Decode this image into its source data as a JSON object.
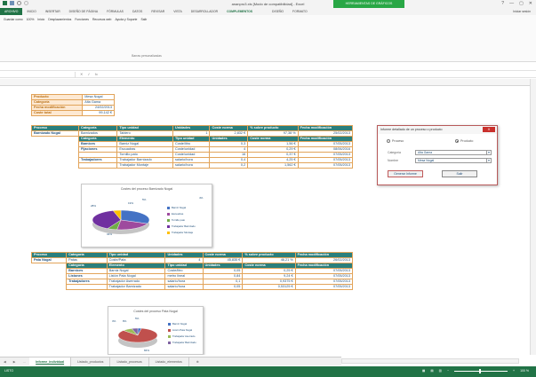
{
  "window": {
    "title": "ananpro3.xls [Modo de compatibilidad] - Excel",
    "tools_label": "HERRAMIENTAS DE GRÁFICOS",
    "controls": [
      "?",
      "—",
      "▢",
      "✕"
    ]
  },
  "ribbon": {
    "tabs": [
      "ARCHIVO",
      "INICIO",
      "INSERTAR",
      "DISEÑO DE PÁGINA",
      "FÓRMULAS",
      "DATOS",
      "REVISAR",
      "VISTA",
      "DESARROLLADOR",
      "COMPLEMENTOS",
      "DISEÑO",
      "FORMATO"
    ],
    "active_tab": "COMPLEMENTOS",
    "user": "Iniciar sesión",
    "toolbar": [
      "Guardar como",
      "100%",
      "Inicio",
      "Desplazamientos",
      "Funciones",
      "Recursos web",
      "Ayuda y Soporte",
      "Salir"
    ],
    "group_label": "Barras personalizadas"
  },
  "formula_bar": {
    "fx": "fx"
  },
  "summary": {
    "rows": [
      {
        "label": "Producto",
        "value": "Mesa Nogal"
      },
      {
        "label": "Categoría",
        "value": "Alta Gama"
      },
      {
        "label": "Fecha modificación",
        "value": "24/02/2013"
      },
      {
        "label": "Coste total",
        "value": "99,142 €"
      }
    ]
  },
  "process1": {
    "header": [
      "Proceso",
      "Categoría",
      "Tipo unidad",
      "Unidades",
      "Coste norma",
      "% sobre producto",
      "Fecha modificación"
    ],
    "main": [
      "Barnizado Nogal",
      "Barnizados",
      "Tablero",
      "1",
      "2,832 €",
      "97,38 %",
      "25/02/2013"
    ],
    "subheader": [
      "Categoría",
      "Elemento",
      "Tipo unidad",
      "Unidades",
      "Coste norma",
      "Fecha modificación"
    ],
    "rows": [
      [
        "Barnices",
        "Barniz Nogal",
        "Coste/litro",
        "0,3",
        "1,56 €",
        "07/05/2013"
      ],
      [
        "Fijaciones",
        "Escuadras",
        "Coste/unidad",
        "4",
        "0,29 €",
        "08/06/2016"
      ],
      [
        "",
        "Tornillo pato",
        "Coste/unidad",
        "16",
        "0,37 €",
        "07/05/2013"
      ],
      [
        "Trabajadores",
        "Trabajador Barnizado",
        "salario/hora",
        "0,4",
        "4,25 €",
        "07/05/2013"
      ],
      [
        "",
        "Trabajador Montaje",
        "salario/hora",
        "0,2",
        "1,562 €",
        "07/05/2013"
      ]
    ]
  },
  "chart1": {
    "title": "Costes del proceso Barnizado Nogal",
    "slices": [
      {
        "name": "Barniz Nogal",
        "pct": 28,
        "color": "#4472c4"
      },
      {
        "name": "Escuadras",
        "pct": 19,
        "color": "#9e4a9e"
      },
      {
        "name": "Tornillo pato",
        "pct": 5,
        "color": "#70ad47"
      },
      {
        "name": "Trabajador Barnizado",
        "pct": 34,
        "color": "#7030a0"
      },
      {
        "name": "Trabajador Montaje",
        "pct": 4,
        "color": "#ffc000"
      }
    ],
    "labels": [
      "28%",
      "19%",
      "5%",
      "34%",
      "4%"
    ]
  },
  "process2": {
    "header": [
      "Proceso",
      "Categoría",
      "Tipo unidad",
      "Unidades",
      "Coste norma",
      "% sobre producto",
      "Fecha modificación"
    ],
    "main": [
      "Pata Nogal",
      "Patas",
      "Coste/Pata",
      "4",
      "45,835 €",
      "46,21 %",
      "26/02/2013"
    ],
    "subheader": [
      "Categoría",
      "Elemento",
      "Tipo unidad",
      "Unidades",
      "Coste norma",
      "Fecha modificación"
    ],
    "rows": [
      [
        "Barnices",
        "Barniz Nogal",
        "Coste/litro",
        "0,05",
        "0,25 €",
        "07/05/2013"
      ],
      [
        "Listones",
        "Listón Pata Nogal",
        "metro lineal",
        "0,84",
        "9,24 €",
        "07/05/2013"
      ],
      [
        "Trabajadores",
        "Trabajador Aserrado",
        "salario/hora",
        "0,1",
        "0,9375 €",
        "07/05/2013"
      ],
      [
        "",
        "Trabajador Barnizado",
        "salario/hora",
        "0,05",
        "0,53125 €",
        "07/05/2013"
      ]
    ]
  },
  "chart2": {
    "title": "Costes del proceso Pata Nogal",
    "slices": [
      {
        "name": "Barniz Nogal",
        "pct": 3,
        "color": "#4472c4"
      },
      {
        "name": "Listón Pata Nogal",
        "pct": 84,
        "color": "#c0504d"
      },
      {
        "name": "Trabajador Aserrado",
        "pct": 8,
        "color": "#9bbb59"
      },
      {
        "name": "Trabajador Barnizado",
        "pct": 5,
        "color": "#8064a2"
      }
    ],
    "labels": [
      "3%",
      "8%",
      "5%",
      "84%"
    ]
  },
  "dialog": {
    "title": "Informe detallado de un proceso o producto",
    "close": "X",
    "radio_proceso": "Proceso",
    "radio_producto": "Producto",
    "categoria_label": "Categoría",
    "categoria_value": "Alta Gama",
    "nombre_label": "Nombre",
    "nombre_value": "Mesa Nogal",
    "btn_generate": "Generar Informe",
    "btn_exit": "Salir"
  },
  "sheet_tabs": [
    "Informe_individual",
    "Listado_productos",
    "Listado_procesos",
    "Listado_elementos"
  ],
  "active_sheet": "Informe_individual",
  "statusbar": {
    "left": "LISTO",
    "zoom": "100 %"
  }
}
